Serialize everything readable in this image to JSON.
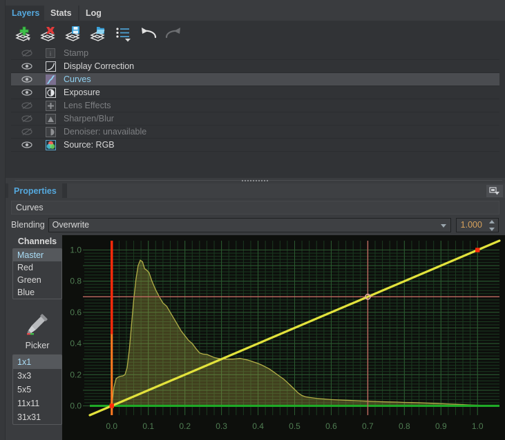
{
  "tabs": [
    {
      "label": "Layers",
      "active": true
    },
    {
      "label": "Stats",
      "active": false
    },
    {
      "label": "Log",
      "active": false
    }
  ],
  "toolbar": {
    "add_layer": "add-layer",
    "delete_layer": "delete-layer",
    "save_layer": "save-layer",
    "load_layer": "load-layer",
    "layer_presets": "layer-presets",
    "undo": "undo",
    "redo": "redo"
  },
  "layers": [
    {
      "name": "Stamp",
      "visible": false,
      "enabled": false,
      "selected": false,
      "icon": "stamp-icon"
    },
    {
      "name": "Display Correction",
      "visible": true,
      "enabled": true,
      "selected": false,
      "icon": "curve-icon"
    },
    {
      "name": "Curves",
      "visible": true,
      "enabled": true,
      "selected": true,
      "icon": "curves-icon"
    },
    {
      "name": "Exposure",
      "visible": true,
      "enabled": true,
      "selected": false,
      "icon": "exposure-icon"
    },
    {
      "name": "Lens Effects",
      "visible": false,
      "enabled": false,
      "selected": false,
      "icon": "lens-effects-icon"
    },
    {
      "name": "Sharpen/Blur",
      "visible": false,
      "enabled": false,
      "selected": false,
      "icon": "sharpen-blur-icon"
    },
    {
      "name": "Denoiser: unavailable",
      "visible": false,
      "enabled": false,
      "selected": false,
      "icon": "denoiser-icon"
    },
    {
      "name": "Source: RGB",
      "visible": true,
      "enabled": true,
      "selected": false,
      "icon": "rgb-source-icon"
    }
  ],
  "properties": {
    "tab_label": "Properties",
    "expand_icon": "expand-panel-icon",
    "layer_name": "Curves",
    "blending_label": "Blending",
    "blending_value": "Overwrite",
    "opacity_value": "1.000"
  },
  "channels": {
    "title": "Channels",
    "items": [
      {
        "label": "Master",
        "selected": true
      },
      {
        "label": "Red",
        "selected": false
      },
      {
        "label": "Green",
        "selected": false
      },
      {
        "label": "Blue",
        "selected": false
      }
    ],
    "picker_label": "Picker",
    "picker_icon": "eyedropper-icon",
    "sizes": [
      {
        "label": "1x1",
        "selected": true
      },
      {
        "label": "3x3",
        "selected": false
      },
      {
        "label": "5x5",
        "selected": false
      },
      {
        "label": "11x11",
        "selected": false
      },
      {
        "label": "31x31",
        "selected": false
      }
    ]
  },
  "colors": {
    "accent": "#55a8dd",
    "panel": "#313336",
    "window": "#3a3c3f",
    "plot_bg": "#0d0f0c",
    "grid_major": "#2b5a30",
    "grid_minor": "#1b3a20",
    "tick_text": "#4f7d52",
    "curve_line": "#e2e23c",
    "histogram": "#b9b44a",
    "green_line": "#1faa27",
    "red_marker": "#ff2a0a",
    "crosshair": "#c06a60",
    "orange_marker": "#ff7a20",
    "spin_value": "#d8a25c"
  },
  "chart_data": {
    "type": "line",
    "title": "",
    "xlabel": "",
    "ylabel": "",
    "xlim": [
      -0.06,
      1.06
    ],
    "ylim": [
      -0.06,
      1.06
    ],
    "grid": true,
    "grid_major_step": 0.1,
    "grid_minor_step": 0.02,
    "xticks": [
      0.0,
      0.1,
      0.2,
      0.3,
      0.4,
      0.5,
      0.6,
      0.7,
      0.8,
      0.9,
      1.0
    ],
    "xticklabels": [
      "0.0",
      "0.1",
      "0.2",
      "0.3",
      "0.4",
      "0.5",
      "0.6",
      "0.7",
      "0.8",
      "0.9",
      "1.0"
    ],
    "yticks": [
      0.0,
      0.2,
      0.4,
      0.6,
      0.8,
      1.0
    ],
    "yticklabels": [
      "0.0",
      "0.2",
      "0.4",
      "0.6",
      "0.8",
      "1.0"
    ],
    "series": [
      {
        "name": "tone curve",
        "type": "line",
        "color": "#e2e23c",
        "points": [
          [
            0.0,
            0.0
          ],
          [
            1.0,
            1.0
          ]
        ],
        "control_points": [
          [
            0.0,
            0.0
          ],
          [
            1.0,
            1.0
          ]
        ]
      },
      {
        "name": "green baseline",
        "type": "line",
        "color": "#1faa27",
        "points": [
          [
            -0.06,
            0.0
          ],
          [
            1.06,
            0.0
          ]
        ]
      },
      {
        "name": "histogram",
        "type": "area",
        "color": "#b9b44a",
        "x": [
          0.0,
          0.006,
          0.012,
          0.018,
          0.024,
          0.03,
          0.036,
          0.042,
          0.048,
          0.054,
          0.06,
          0.066,
          0.072,
          0.078,
          0.084,
          0.09,
          0.096,
          0.102,
          0.11,
          0.12,
          0.13,
          0.14,
          0.15,
          0.16,
          0.17,
          0.18,
          0.19,
          0.2,
          0.21,
          0.22,
          0.23,
          0.24,
          0.25,
          0.26,
          0.27,
          0.28,
          0.29,
          0.3,
          0.31,
          0.32,
          0.33,
          0.34,
          0.35,
          0.36,
          0.37,
          0.38,
          0.39,
          0.4,
          0.41,
          0.42,
          0.43,
          0.44,
          0.45,
          0.46,
          0.47,
          0.48,
          0.49,
          0.5,
          0.51,
          0.52,
          0.53,
          0.54,
          0.56,
          0.58,
          0.6,
          0.62,
          0.64,
          0.66,
          0.68,
          0.7,
          0.72,
          0.74,
          0.76,
          0.78,
          0.8,
          0.82,
          0.84,
          0.86,
          0.88,
          0.9,
          0.92,
          0.94,
          0.96,
          0.98,
          1.0,
          1.02
        ],
        "y": [
          0.0,
          0.12,
          0.175,
          0.185,
          0.19,
          0.192,
          0.2,
          0.245,
          0.36,
          0.52,
          0.68,
          0.81,
          0.9,
          0.935,
          0.925,
          0.88,
          0.87,
          0.855,
          0.8,
          0.745,
          0.7,
          0.66,
          0.64,
          0.6,
          0.56,
          0.52,
          0.48,
          0.45,
          0.42,
          0.4,
          0.368,
          0.34,
          0.332,
          0.33,
          0.32,
          0.31,
          0.305,
          0.302,
          0.3,
          0.3,
          0.3,
          0.302,
          0.305,
          0.3,
          0.295,
          0.288,
          0.28,
          0.272,
          0.262,
          0.25,
          0.238,
          0.222,
          0.205,
          0.188,
          0.172,
          0.15,
          0.128,
          0.105,
          0.082,
          0.066,
          0.058,
          0.054,
          0.048,
          0.044,
          0.04,
          0.038,
          0.036,
          0.034,
          0.032,
          0.03,
          0.028,
          0.026,
          0.025,
          0.024,
          0.022,
          0.021,
          0.02,
          0.018,
          0.016,
          0.014,
          0.012,
          0.01,
          0.008,
          0.006,
          0.004,
          0.003
        ]
      }
    ],
    "markers": [
      {
        "name": "cursor-crosshair",
        "x": 0.7,
        "y": 0.7,
        "color": "#c06a60"
      },
      {
        "name": "red-vertical-line",
        "x": 0.0,
        "color": "#ff2a0a"
      },
      {
        "name": "curve-endpoint",
        "x": 1.0,
        "y": 1.0,
        "color": "#ff2a0a"
      },
      {
        "name": "curve-origin-point",
        "x": 0.0,
        "y": 0.0,
        "color": "#ff2a0a"
      }
    ]
  }
}
